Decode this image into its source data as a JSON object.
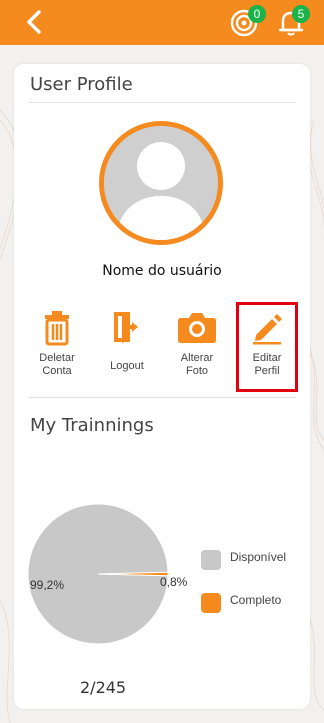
{
  "header": {
    "back_icon": "chevron-left-icon",
    "badge_left": "0",
    "badge_right": "5",
    "brand_color": "#f58a1f",
    "badge_color": "#19b34a"
  },
  "profile": {
    "title": "User Profile",
    "username": "Nome do usuário",
    "actions": [
      {
        "label": "Deletar\nConta",
        "icon": "trash-icon"
      },
      {
        "label": "Logout",
        "icon": "logout-icon"
      },
      {
        "label": "Alterar\nFoto",
        "icon": "camera-icon"
      },
      {
        "label": "Editar\nPerfil",
        "icon": "pencil-icon"
      }
    ]
  },
  "trainings": {
    "title": "My Trainnings",
    "ratio": "2/245"
  },
  "chart_data": {
    "type": "pie",
    "categories": [
      "Disponível",
      "Completo"
    ],
    "values": [
      99.2,
      0.8
    ],
    "labels": [
      "99,2%",
      "0,8%"
    ],
    "legend_labels": [
      "Disponível",
      "Completo"
    ],
    "colors": [
      "#c8c8c8",
      "#f58a1f"
    ],
    "legend": "right"
  }
}
